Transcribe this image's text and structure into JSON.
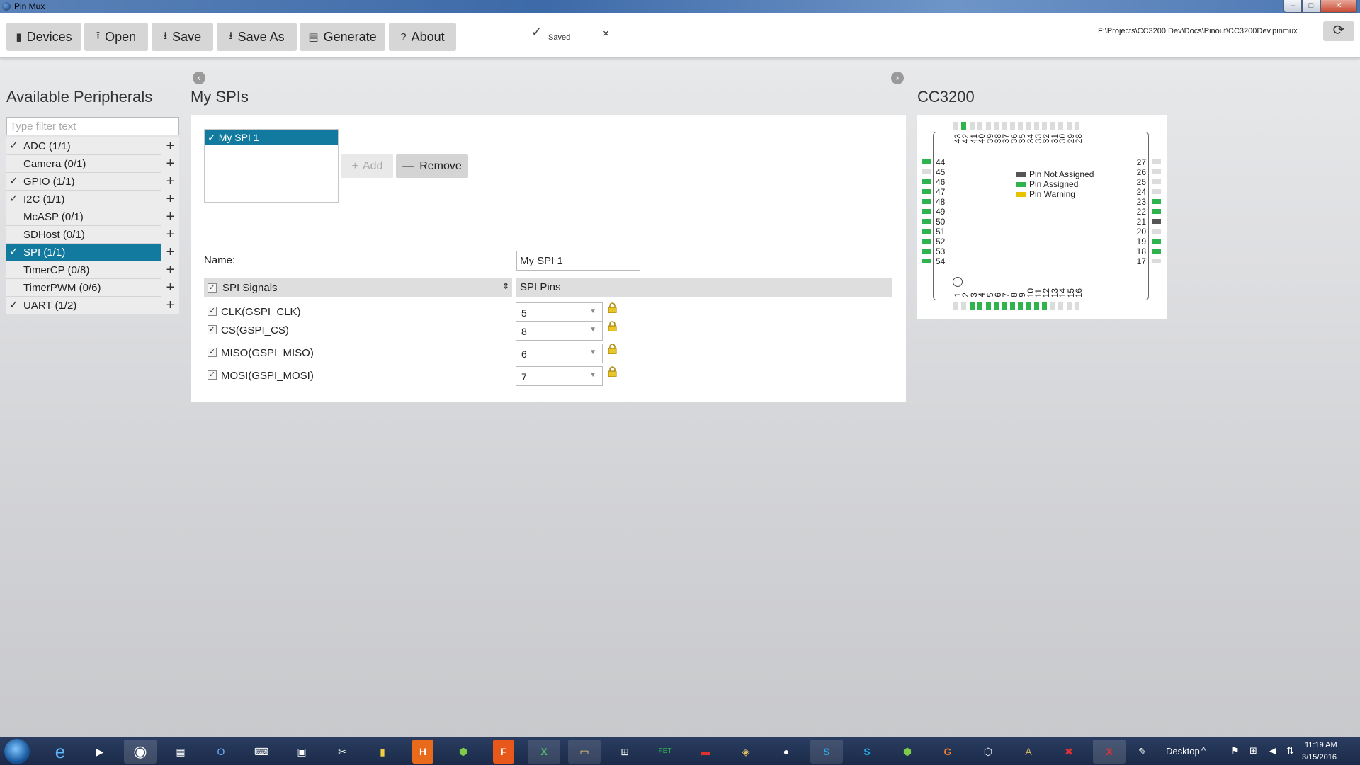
{
  "window": {
    "title": "Pin Mux",
    "min": "–",
    "max": "□",
    "close": "✕"
  },
  "toolbar": {
    "devices": "Devices",
    "open": "Open",
    "save": "Save",
    "save_as": "Save As",
    "generate": "Generate",
    "about": "About",
    "saved": "Saved",
    "saved_close": "×",
    "file_path": "F:\\Projects\\CC3200 Dev\\Docs\\Pinout\\CC3200Dev.pinmux"
  },
  "peripherals": {
    "title": "Available Peripherals",
    "filter_placeholder": "Type filter text",
    "items": [
      {
        "label": "ADC (1/1)",
        "checked": "✓"
      },
      {
        "label": "Camera (0/1)",
        "checked": ""
      },
      {
        "label": "GPIO (1/1)",
        "checked": "✓"
      },
      {
        "label": "I2C (1/1)",
        "checked": "✓"
      },
      {
        "label": "McASP (0/1)",
        "checked": ""
      },
      {
        "label": "SDHost (0/1)",
        "checked": ""
      },
      {
        "label": "SPI (1/1)",
        "checked": "✓"
      },
      {
        "label": "TimerCP (0/8)",
        "checked": ""
      },
      {
        "label": "TimerPWM (0/6)",
        "checked": ""
      },
      {
        "label": "UART (1/2)",
        "checked": "✓"
      }
    ],
    "selected": "SPI (1/1)"
  },
  "spi": {
    "title": "My SPIs",
    "instance": "My SPI 1",
    "add": "Add",
    "remove": "Remove",
    "name_label": "Name:",
    "name_value": "My SPI 1",
    "col_signals": "SPI Signals",
    "col_pins": "SPI Pins",
    "signals": [
      {
        "name": "CLK(GSPI_CLK)",
        "pin": "5"
      },
      {
        "name": "CS(GSPI_CS)",
        "pin": "8"
      },
      {
        "name": "MISO(GSPI_MISO)",
        "pin": "6"
      },
      {
        "name": "MOSI(GSPI_MOSI)",
        "pin": "7"
      }
    ]
  },
  "chip": {
    "title": "CC3200",
    "legend": {
      "not_assigned": "Pin Not Assigned",
      "assigned": "Pin Assigned",
      "warning": "Pin Warning"
    },
    "colors": {
      "assigned": "#2fb34e",
      "not_assigned": "#555555",
      "warning": "#e8c400",
      "unused": "#dcdcdc"
    },
    "top_pins": [
      "43",
      "42",
      "41",
      "40",
      "39",
      "38",
      "37",
      "36",
      "35",
      "34",
      "33",
      "32",
      "31",
      "30",
      "29",
      "28"
    ],
    "top_state": [
      "u",
      "a",
      "u",
      "u",
      "u",
      "u",
      "u",
      "u",
      "u",
      "u",
      "u",
      "u",
      "u",
      "u",
      "u",
      "u"
    ],
    "left_pins": [
      "44",
      "45",
      "46",
      "47",
      "48",
      "49",
      "50",
      "51",
      "52",
      "53",
      "54"
    ],
    "left_state": [
      "a",
      "u",
      "a",
      "a",
      "a",
      "a",
      "a",
      "a",
      "a",
      "a",
      "a"
    ],
    "right_pins": [
      "27",
      "26",
      "25",
      "24",
      "23",
      "22",
      "21",
      "20",
      "19",
      "18",
      "17"
    ],
    "right_state": [
      "u",
      "u",
      "u",
      "u",
      "a",
      "a",
      "n",
      "u",
      "a",
      "a",
      "u"
    ],
    "bottom_pins": [
      "1",
      "2",
      "3",
      "4",
      "5",
      "6",
      "7",
      "8",
      "9",
      "10",
      "11",
      "12",
      "13",
      "14",
      "15",
      "16"
    ],
    "bottom_state": [
      "u",
      "u",
      "a",
      "a",
      "a",
      "a",
      "a",
      "a",
      "a",
      "a",
      "a",
      "a",
      "u",
      "u",
      "u",
      "u"
    ]
  },
  "taskbar": {
    "desktop": "Desktop",
    "time": "11:19 AM",
    "date": "3/15/2016"
  }
}
